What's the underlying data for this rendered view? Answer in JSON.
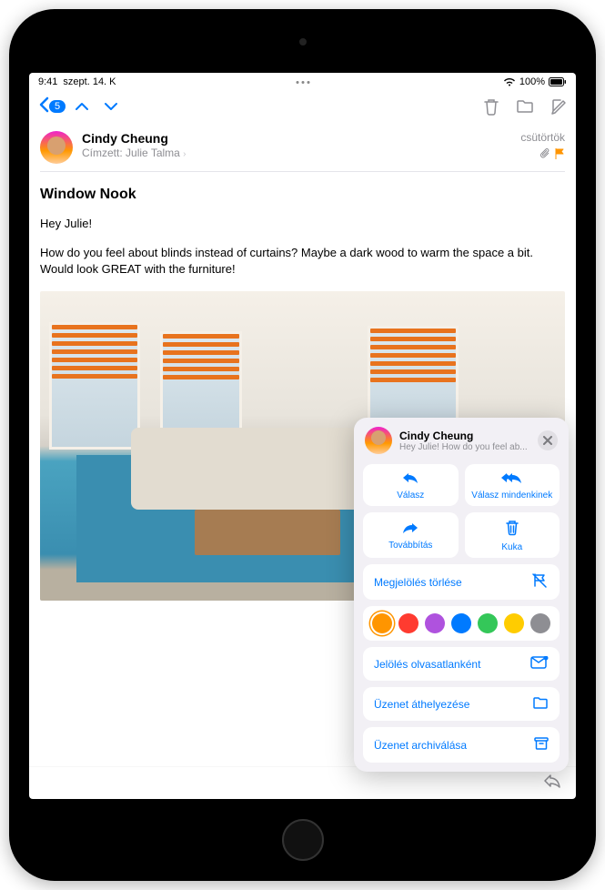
{
  "status": {
    "time": "9:41",
    "date": "szept. 14. K",
    "battery": "100%"
  },
  "toolbar": {
    "back_count": "5"
  },
  "mail": {
    "sender": "Cindy Cheung",
    "recipient_label": "Címzett:",
    "recipient_name": "Julie Talma",
    "date": "csütörtök",
    "subject": "Window Nook",
    "greeting": "Hey Julie!",
    "body": "How do you feel about blinds instead of curtains? Maybe a dark wood to warm the space a bit. Would look GREAT with the furniture!"
  },
  "sheet": {
    "title": "Cindy Cheung",
    "preview": "Hey Julie! How do you feel ab...",
    "reply": "Válasz",
    "reply_all": "Válasz mindenkinek",
    "forward": "Továbbítás",
    "trash": "Kuka",
    "unflag": "Megjelölés törlése",
    "mark_unread": "Jelölés olvasatlanként",
    "move": "Üzenet áthelyezése",
    "archive": "Üzenet archiválása",
    "colors": [
      "#ff9500",
      "#ff3b30",
      "#af52de",
      "#007aff",
      "#34c759",
      "#ffcc00",
      "#8e8e93"
    ]
  }
}
